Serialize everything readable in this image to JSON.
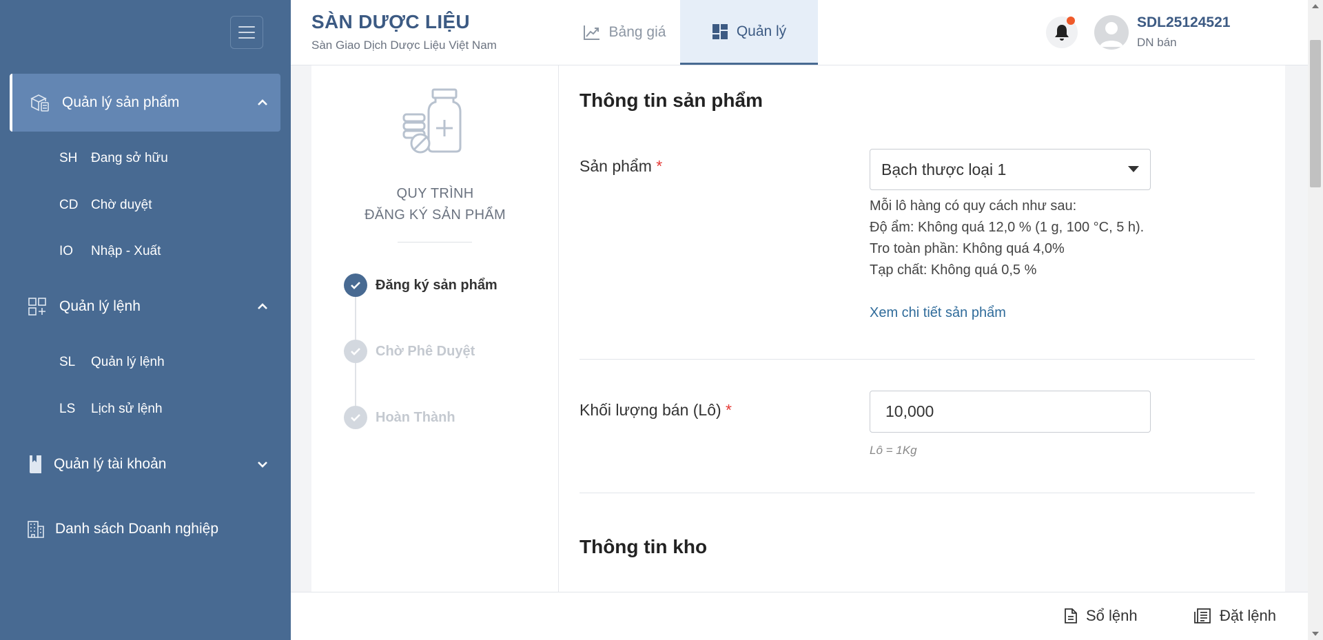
{
  "brand": {
    "title": "SÀN DƯỢC LIỆU",
    "subtitle": "Sàn Giao Dịch Dược Liệu Việt Nam"
  },
  "tabs": [
    {
      "label": "Bảng giá",
      "icon": "chart-line-icon",
      "active": false
    },
    {
      "label": "Quản lý",
      "icon": "dashboard-icon",
      "active": true
    }
  ],
  "user": {
    "id": "SDL25124521",
    "role": "DN bán"
  },
  "sidebar": {
    "sections": [
      {
        "label": "Quản lý sản phẩm",
        "icon": "product-boxes-icon",
        "expanded": true,
        "active": true
      },
      {
        "label": "Quản lý lệnh",
        "icon": "grid-add-icon",
        "expanded": true,
        "active": false
      },
      {
        "label": "Quản lý tài khoản",
        "icon": "account-book-icon",
        "expanded": false,
        "active": false
      },
      {
        "label": "Danh sách Doanh nghiệp",
        "icon": "building-icon",
        "expanded": false,
        "active": false
      }
    ],
    "product_items": [
      {
        "abbr": "SH",
        "label": "Đang sở hữu"
      },
      {
        "abbr": "CD",
        "label": "Chờ duyệt"
      },
      {
        "abbr": "IO",
        "label": "Nhập - Xuất"
      }
    ],
    "order_items": [
      {
        "abbr": "SL",
        "label": "Quản lý lệnh"
      },
      {
        "abbr": "LS",
        "label": "Lịch sử lệnh"
      }
    ]
  },
  "process": {
    "title_line1": "QUY TRÌNH",
    "title_line2": "ĐĂNG KÝ SẢN PHẨM",
    "steps": [
      {
        "label": "Đăng ký sản phẩm",
        "status": "done"
      },
      {
        "label": "Chờ Phê Duyệt",
        "status": "pending"
      },
      {
        "label": "Hoàn Thành",
        "status": "pending"
      }
    ]
  },
  "form": {
    "section_product": "Thông tin sản phẩm",
    "product_label": "Sản phẩm",
    "required_mark": "*",
    "product_value": "Bạch thược loại 1",
    "spec_lines": [
      "Mỗi lô hàng có quy cách như sau:",
      "Độ ẩm: Không quá 12,0 % (1 g, 100 °C, 5 h).",
      "Tro toàn phần: Không quá 4,0%",
      "Tạp chất: Không quá 0,5 %"
    ],
    "detail_link": "Xem chi tiết sản phẩm",
    "quantity_label": "Khối lượng bán (Lô)",
    "quantity_value": "10,000",
    "quantity_hint": "Lô = 1Kg",
    "section_warehouse": "Thông tin kho"
  },
  "bottom": {
    "order_book": "Sổ lệnh",
    "place_order": "Đặt lệnh"
  },
  "colors": {
    "sidebar": "#486a92",
    "sidebar_active": "#6386b3",
    "brand": "#3c5a83",
    "link": "#2f6b9a",
    "required": "#e53935",
    "notification": "#ef5a2a"
  }
}
